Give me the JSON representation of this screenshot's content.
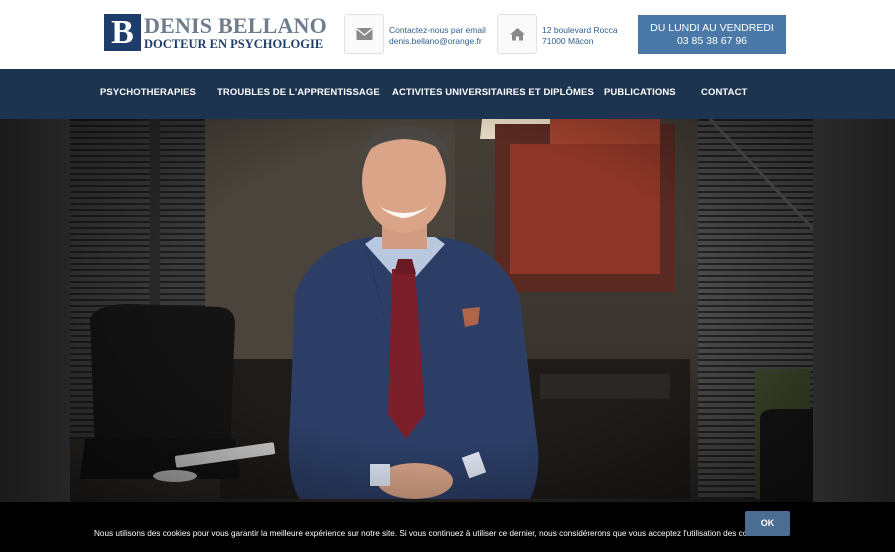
{
  "logo": {
    "mark": "B",
    "name": "DENIS BELLANO",
    "subtitle": "DOCTEUR EN PSYCHOLOGIE"
  },
  "contact": {
    "email_label": "Contactez-nous par email",
    "email": "denis.bellano@orange.fr",
    "address_line1": "12 boulevard Rocca",
    "address_line2": "71000 Mâcon"
  },
  "hours": {
    "line1": "DU LUNDI AU VENDREDI",
    "line2": "03 85 38 67 96"
  },
  "nav": {
    "items": [
      {
        "label": "PSYCHOTHERAPIES"
      },
      {
        "label": "TROUBLES DE L'APPRENTISSAGE"
      },
      {
        "label": "ACTIVITES UNIVERSITAIRES ET DIPLÔMES"
      },
      {
        "label": "PUBLICATIONS"
      },
      {
        "label": "CONTACT"
      }
    ]
  },
  "cookie": {
    "text": "Nous utilisons des cookies pour vous garantir la meilleure expérience sur notre site. Si vous continuez à utiliser ce dernier, nous considérerons que vous acceptez l'utilisation des cookies.",
    "ok_label": "OK"
  },
  "colors": {
    "brand": "#1f3d6b",
    "nav_bg": "#1c3450",
    "accent": "#4a79a7"
  },
  "icons": {
    "email": "envelope-icon",
    "address": "home-icon"
  }
}
